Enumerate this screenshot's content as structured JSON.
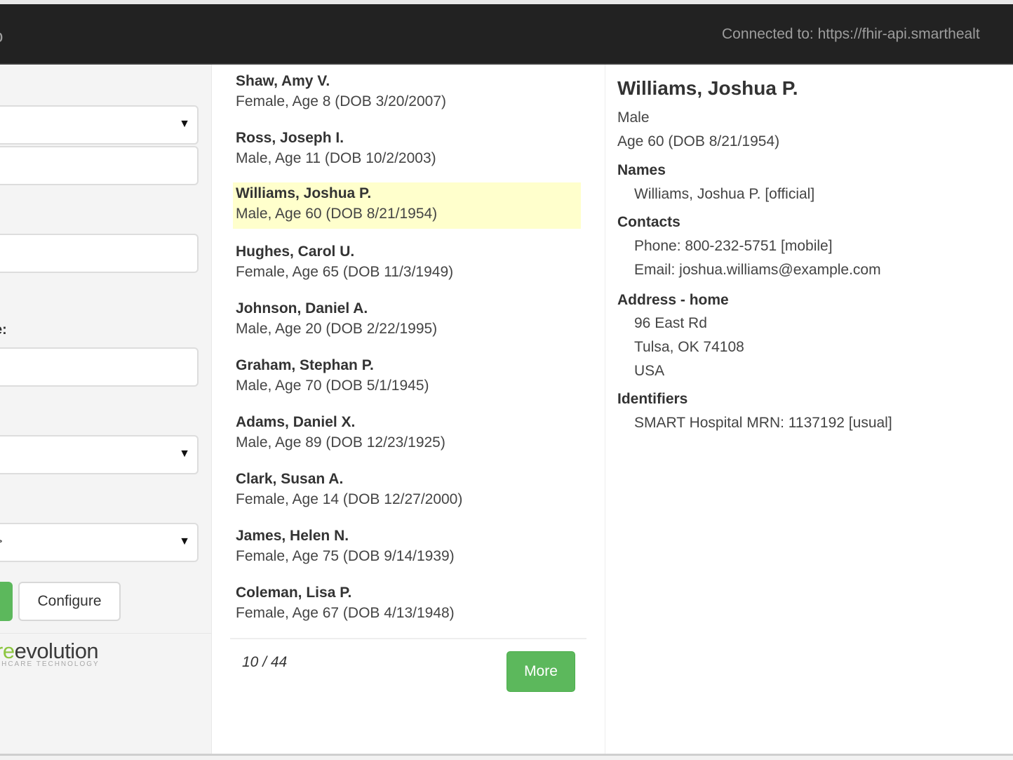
{
  "navbar": {
    "brand_fragment": "o",
    "connected_text": "Connected to: https://fhir-api.smarthealt"
  },
  "sidebar": {
    "labels": [
      ":",
      "e:"
    ],
    "select_3_value": ">",
    "configure_label": "Configure",
    "logo": {
      "green_part": "re",
      "dark_part": "evolution",
      "subtitle": "THCARE TECHNOLOGY"
    }
  },
  "patient_list": {
    "patients": [
      {
        "name": "Shaw, Amy V.",
        "info": "Female, Age 8 (DOB 3/20/2007)"
      },
      {
        "name": "Ross, Joseph I.",
        "info": "Male, Age 11 (DOB 10/2/2003)"
      },
      {
        "name": "Williams, Joshua P.",
        "info": "Male, Age 60 (DOB 8/21/1954)",
        "selected": true
      },
      {
        "name": "Hughes, Carol U.",
        "info": "Female, Age 65 (DOB 11/3/1949)"
      },
      {
        "name": "Johnson, Daniel A.",
        "info": "Male, Age 20 (DOB 2/22/1995)"
      },
      {
        "name": "Graham, Stephan P.",
        "info": "Male, Age 70 (DOB 5/1/1945)"
      },
      {
        "name": "Adams, Daniel X.",
        "info": "Male, Age 89 (DOB 12/23/1925)"
      },
      {
        "name": "Clark, Susan A.",
        "info": "Female, Age 14 (DOB 12/27/2000)"
      },
      {
        "name": "James, Helen N.",
        "info": "Female, Age 75 (DOB 9/14/1939)"
      },
      {
        "name": "Coleman, Lisa P.",
        "info": "Female, Age 67 (DOB 4/13/1948)"
      }
    ],
    "count": "10 / 44",
    "more_label": "More"
  },
  "detail": {
    "title": "Williams, Joshua P.",
    "gender": "Male",
    "age": "Age 60 (DOB 8/21/1954)",
    "names_heading": "Names",
    "names": [
      "Williams, Joshua P. [official]"
    ],
    "contacts_heading": "Contacts",
    "contacts": [
      "Phone: 800-232-5751 [mobile]",
      "Email: joshua.williams@example.com"
    ],
    "address_heading": "Address - home",
    "address": [
      "96 East Rd",
      "Tulsa, OK 74108",
      "USA"
    ],
    "identifiers_heading": "Identifiers",
    "identifiers": [
      "SMART Hospital MRN: 1137192 [usual]"
    ]
  },
  "colors": {
    "navbar_bg": "#222222",
    "accent_green": "#5cb85c",
    "selected_row": "#ffffcc",
    "logo_green": "#8cc63f"
  }
}
